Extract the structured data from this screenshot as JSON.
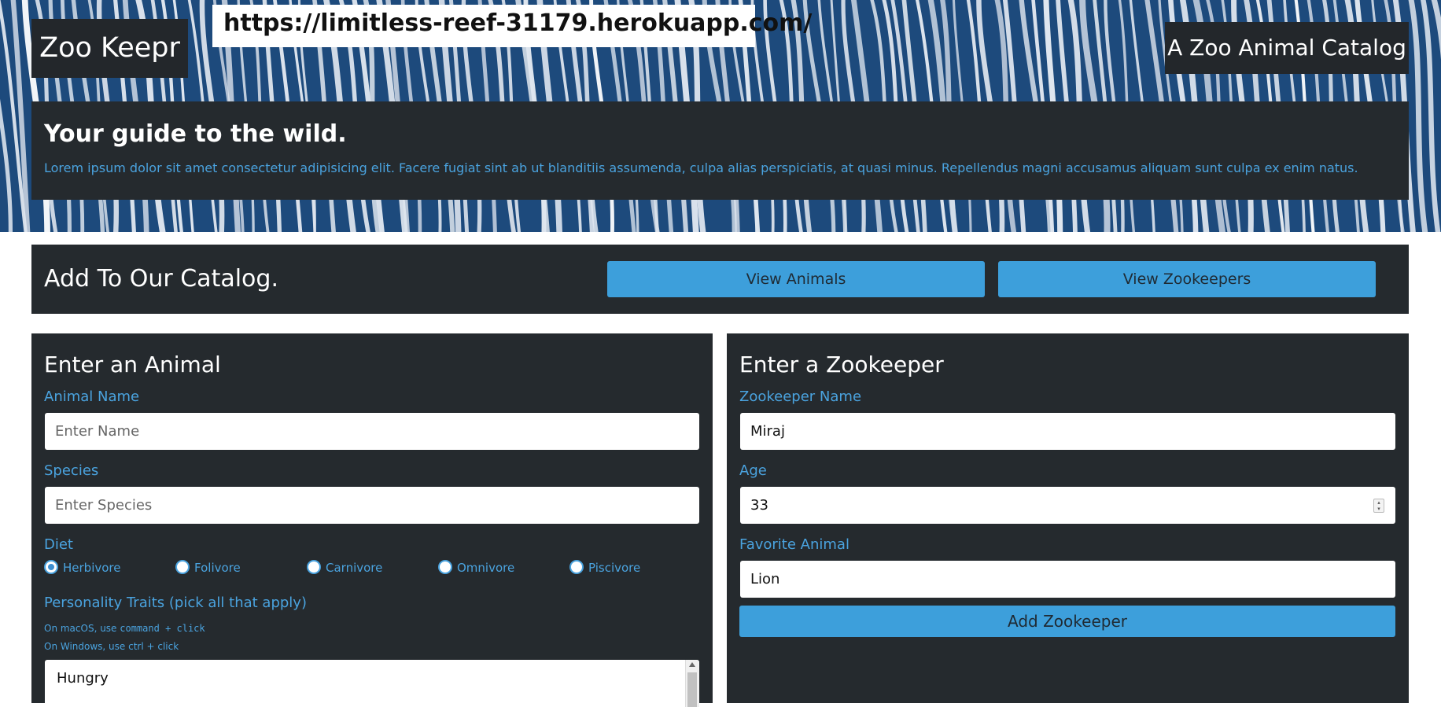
{
  "hero": {
    "url": "https://limitless-reef-31179.herokuapp.com/",
    "brand": "Zoo Keepr",
    "tagline": "A Zoo Animal Catalog",
    "title": "Your guide to the wild.",
    "text": "Lorem ipsum dolor sit amet consectetur adipisicing elit. Facere fugiat sint ab ut blanditiis assumenda, culpa alias perspiciatis, at quasi minus. Repellendus magni accusamus aliquam sunt culpa ex enim natus."
  },
  "catalog": {
    "title": "Add To Our Catalog.",
    "view_animals": "View Animals",
    "view_zookeepers": "View Zookeepers"
  },
  "animal_form": {
    "title": "Enter an Animal",
    "name_label": "Animal Name",
    "name_placeholder": "Enter Name",
    "species_label": "Species",
    "species_placeholder": "Enter Species",
    "diet_label": "Diet",
    "diet_options": [
      "Herbivore",
      "Folivore",
      "Carnivore",
      "Omnivore",
      "Piscivore"
    ],
    "diet_selected": "Herbivore",
    "traits_label": "Personality Traits (pick all that apply)",
    "hint_mac_prefix": "On macOS, use ",
    "hint_mac_code": "command + click",
    "hint_windows": "On Windows, use ctrl + click",
    "traits_options": [
      "Hungry"
    ]
  },
  "zookeeper_form": {
    "title": "Enter a Zookeeper",
    "name_label": "Zookeeper Name",
    "name_value": "Miraj",
    "age_label": "Age",
    "age_value": "33",
    "animal_label": "Favorite Animal",
    "animal_value": "Lion",
    "submit": "Add Zookeeper"
  },
  "colors": {
    "accent": "#3d9fdb",
    "panel": "#252a2e",
    "label_blue": "#4aa3df"
  }
}
